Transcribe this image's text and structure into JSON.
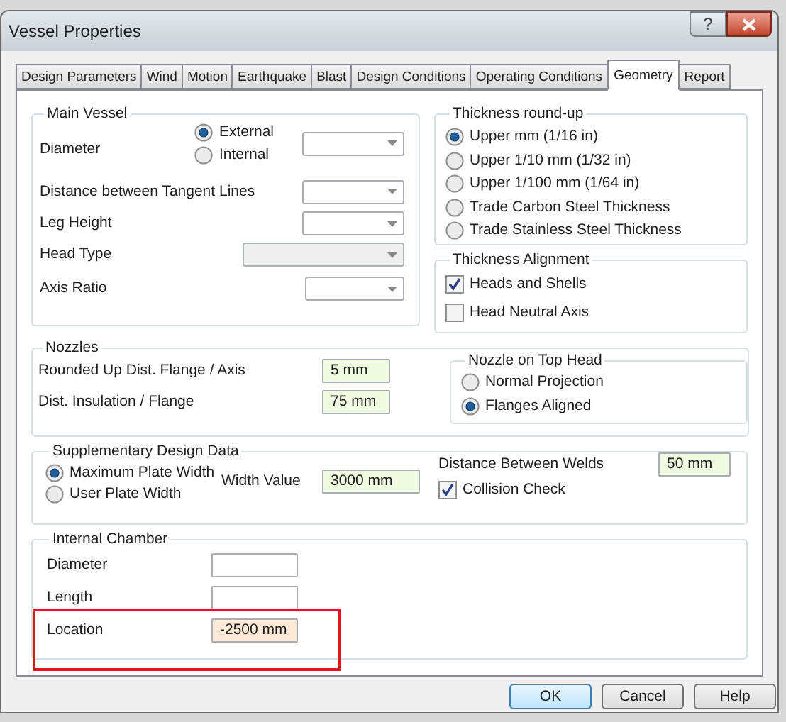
{
  "window": {
    "title": "Vessel Properties",
    "help_glyph": "?"
  },
  "tabs": [
    {
      "label": "Design Parameters",
      "selected": false
    },
    {
      "label": "Wind",
      "selected": false
    },
    {
      "label": "Motion",
      "selected": false
    },
    {
      "label": "Earthquake",
      "selected": false
    },
    {
      "label": "Blast",
      "selected": false
    },
    {
      "label": "Design Conditions",
      "selected": false
    },
    {
      "label": "Operating Conditions",
      "selected": false
    },
    {
      "label": "Geometry",
      "selected": true
    },
    {
      "label": "Report",
      "selected": false
    }
  ],
  "main_vessel": {
    "title": "Main Vessel",
    "fields": [
      {
        "label": "Diameter",
        "kind": "radio_dropdown",
        "disabled": false,
        "options": [
          {
            "label": "External",
            "selected": true
          },
          {
            "label": "Internal",
            "selected": false
          }
        ]
      },
      {
        "label": "Distance between Tangent Lines",
        "kind": "dropdown",
        "disabled": false
      },
      {
        "label": "Leg Height",
        "kind": "dropdown",
        "disabled": false
      },
      {
        "label": "Head Type",
        "kind": "dropdown",
        "disabled": true
      },
      {
        "label": "Axis Ratio",
        "kind": "dropdown",
        "disabled": false
      }
    ]
  },
  "thickness_roundup": {
    "title": "Thickness round-up",
    "options": [
      {
        "label": "Upper mm (1/16 in)",
        "selected": true
      },
      {
        "label": "Upper 1/10 mm (1/32 in)",
        "selected": false
      },
      {
        "label": "Upper 1/100 mm (1/64 in)",
        "selected": false
      },
      {
        "label": "Trade Carbon Steel Thickness",
        "selected": false
      },
      {
        "label": "Trade Stainless Steel Thickness",
        "selected": false
      }
    ]
  },
  "thickness_alignment": {
    "title": "Thickness Alignment",
    "options": [
      {
        "label": "Heads and Shells",
        "checked": true
      },
      {
        "label": "Head Neutral Axis",
        "checked": false
      }
    ]
  },
  "nozzles": {
    "title": "Nozzles",
    "fields": [
      {
        "label": "Rounded Up Dist. Flange / Axis",
        "value": "5 mm"
      },
      {
        "label": "Dist. Insulation / Flange",
        "value": "75 mm"
      }
    ],
    "top_head": {
      "title": "Nozzle on Top Head",
      "options": [
        {
          "label": "Normal Projection",
          "selected": false
        },
        {
          "label": "Flanges Aligned",
          "selected": true
        }
      ]
    }
  },
  "supplementary": {
    "title": "Supplementary Design Data",
    "options": [
      {
        "label": "Maximum Plate Width",
        "selected": true
      },
      {
        "label": "User Plate Width",
        "selected": false
      }
    ],
    "width_label": "Width Value",
    "width_value": "3000 mm",
    "welds_label": "Distance Between Welds",
    "welds_value": "50 mm",
    "collision": {
      "label": "Collision Check",
      "checked": true
    }
  },
  "internal_chamber": {
    "title": "Internal Chamber",
    "fields": [
      {
        "label": "Diameter",
        "annotated": false
      },
      {
        "label": "Length",
        "annotated": false
      },
      {
        "label": "Location",
        "value": "-2500 mm",
        "annotated": true
      }
    ]
  },
  "buttons": [
    {
      "label": "OK",
      "default": true
    },
    {
      "label": "Cancel",
      "default": false
    },
    {
      "label": "Help",
      "default": false
    }
  ]
}
